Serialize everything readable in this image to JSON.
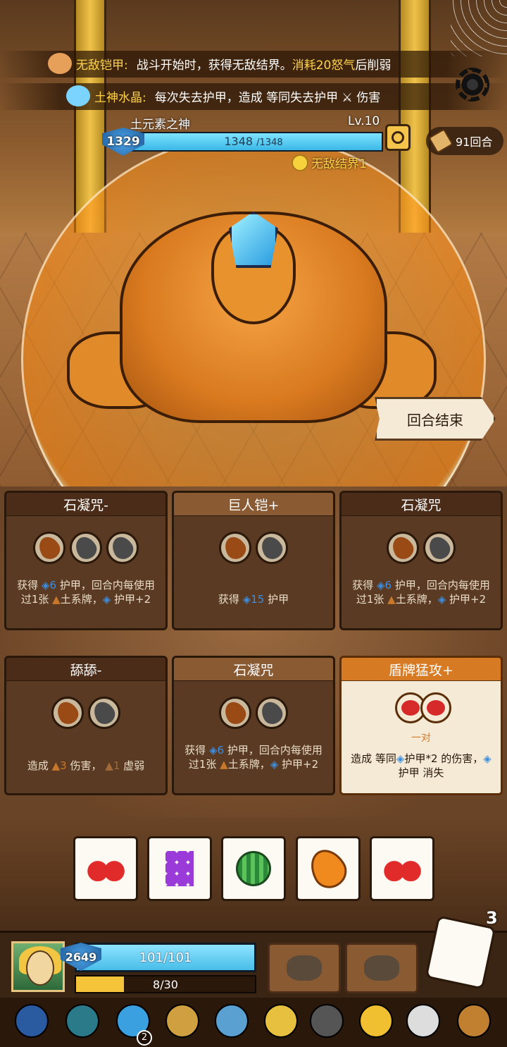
{
  "buffs": [
    {
      "name": "无敌铠甲:",
      "text": "战斗开始时，获得无敌结界。",
      "highlight": "消耗20怒气",
      "tail": "后削弱",
      "icon": "fist-icon"
    },
    {
      "name": "土神水晶:",
      "text": "每次失去护甲，造成 等同失去护甲",
      "highlight": "",
      "tail": "伤害",
      "icon": "crystal-icon"
    }
  ],
  "enemy": {
    "name": "土元素之神",
    "level": "Lv.10",
    "shield": "1329",
    "hp_current": "1348",
    "hp_max": "/1348",
    "hp_fraction": 1.0,
    "status": "无敌结界1"
  },
  "turn_counter": "91回合",
  "end_turn_label": "回合结束",
  "cards": [
    {
      "title": "石凝咒-",
      "slots": [
        "orange",
        "gray",
        "gray"
      ],
      "desc_parts": [
        "获得 ",
        "6",
        " 护甲，回合内每使用过1张 ",
        "土系牌，",
        " 护甲+2"
      ]
    },
    {
      "title": "巨人铠+",
      "slots": [
        "orange",
        "gray"
      ],
      "desc_parts": [
        "获得 ",
        "15",
        " 护甲"
      ]
    },
    {
      "title": "石凝咒",
      "slots": [
        "orange",
        "gray"
      ],
      "desc_parts": [
        "获得 ",
        "6",
        " 护甲，回合内每使用过1张 ",
        "土系牌，",
        " 护甲+2"
      ]
    },
    {
      "title": "舔舔-",
      "slots": [
        "orange",
        "gray"
      ],
      "desc_parts": [
        "造成 ",
        "3",
        " 伤害， ",
        "1",
        " 虚弱"
      ]
    },
    {
      "title": "石凝咒",
      "slots": [
        "orange",
        "gray"
      ],
      "desc_parts": [
        "获得 ",
        "6",
        " 护甲，回合内每使用过1张 ",
        "土系牌，",
        " 护甲+2"
      ]
    },
    {
      "title": "盾牌猛攻+",
      "pair_label": "一对",
      "desc_parts": [
        "造成 等同",
        "护甲*2",
        " 的伤害，",
        "护甲",
        " 消失"
      ]
    }
  ],
  "dice": [
    "cherry",
    "grape",
    "watermelon",
    "mango",
    "cherry"
  ],
  "dice_remaining": "3",
  "player": {
    "shield": "2649",
    "hp": "101/101",
    "hp_fraction": 1.0,
    "energy": "8/30",
    "energy_fraction": 0.2667
  },
  "relics": [
    "squid-relic",
    "beetle-relic",
    "whirlpool-relic",
    "compass-relic",
    "pumpkin-shield-relic",
    "golden-helmet-relic",
    "iron-ring-relic",
    "crown-relic",
    "claw-relic",
    "gauntlet-relic"
  ],
  "relic_badge": "2"
}
